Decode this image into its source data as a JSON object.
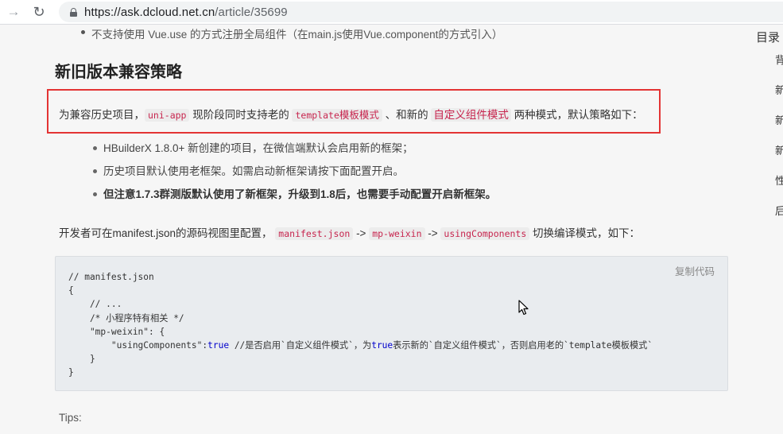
{
  "browser": {
    "back_icon": "←",
    "forward_icon": "→",
    "reload_icon": "↻",
    "url_host": "https://ask.dcloud.net.cn",
    "url_path": "/article/35699"
  },
  "article": {
    "top_bullet": "不支持使用 Vue.use 的方式注册全局组件（在main.js使用Vue.component的方式引入）",
    "heading": "新旧版本兼容策略",
    "intro": {
      "part1": "为兼容历史项目，",
      "code1": "uni-app",
      "part2": " 现阶段同时支持老的 ",
      "code2": "template",
      "code2_zh": "模板模式",
      "part3": " 、和新的 ",
      "code3_zh": "自定义组件模式",
      "part4": " 两种模式，默认策略如下："
    },
    "points": [
      "HBuilderX 1.8.0+ 新创建的项目，在微信端默认会启用新的框架；",
      "历史项目默认使用老框架。如需启动新框架请按下面配置开启。",
      "但注意1.7.3群测版默认使用了新框架，升级到1.8后，也需要手动配置开启新框架。"
    ],
    "config": {
      "part1": "开发者可在manifest.json的源码视图里配置， ",
      "code1": "manifest.json",
      "arrow1": " -> ",
      "code2": "mp-weixin",
      "arrow2": " -> ",
      "code3": "usingComponents",
      "part2": " 切换编译模式，如下："
    },
    "code_block": {
      "copy_label": "复制代码",
      "line1": "// manifest.json",
      "line2": "{",
      "line3": "    // ...",
      "line4": "    /* 小程序特有相关 */",
      "line5": "    \"mp-weixin\": {",
      "line6a": "        \"usingComponents\":",
      "line6b": "true",
      "line6c": " //是否启用`自定义组件模式`，为",
      "line6d": "true",
      "line6e": "表示新的`自定义组件模式`，否则启用老的`template模板模式`",
      "line7": "    }",
      "line8": "}"
    },
    "tips": "Tips:"
  },
  "toc": {
    "title": "目录",
    "items": [
      "背",
      "新",
      "新",
      "新",
      "性",
      "后"
    ]
  },
  "colors": {
    "highlight_border": "#e33434",
    "inline_code": "#c7254e",
    "keyword": "#0000cc"
  }
}
